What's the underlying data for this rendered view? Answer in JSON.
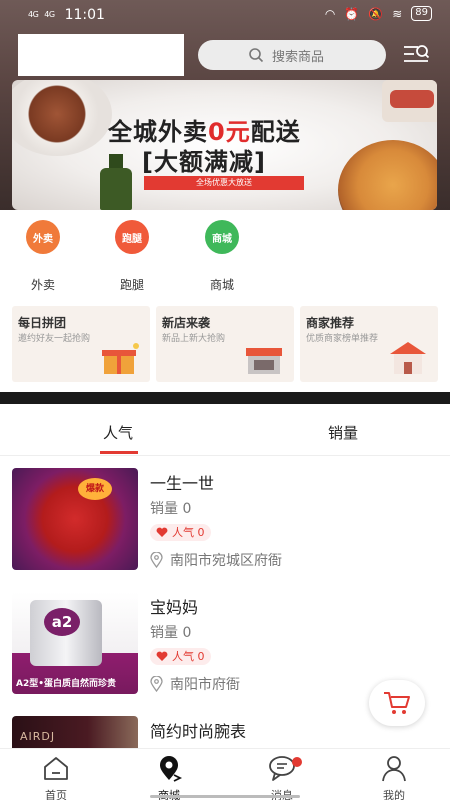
{
  "status_bar": {
    "network_1": "4G",
    "network_2": "4G",
    "time": "11:01",
    "battery": "89"
  },
  "header": {
    "search_placeholder": "搜索商品"
  },
  "banner": {
    "headline_part1": "全城外卖",
    "headline_highlight": "0元",
    "headline_part2": "配送",
    "subline": "[大额满减]",
    "tag": "全场优惠大放送"
  },
  "quick_entries": [
    {
      "icon_text": "外卖",
      "label": "外卖",
      "color": "#f07a3a"
    },
    {
      "icon_text": "跑腿",
      "label": "跑腿",
      "color": "#f05a3a"
    },
    {
      "icon_text": "商城",
      "label": "商城",
      "color": "#3fb85a"
    }
  ],
  "promos": [
    {
      "title": "每日拼团",
      "subtitle": "邀约好友一起抢购"
    },
    {
      "title": "新店来袭",
      "subtitle": "新品上新大抢购"
    },
    {
      "title": "商家推荐",
      "subtitle": "优质商家榜单推荐"
    }
  ],
  "tabs": {
    "popular": "人气",
    "sales": "销量"
  },
  "products": [
    {
      "title": "一生一世",
      "sales": "销量 0",
      "popularity": "人气 0",
      "address": "南阳市宛城区府衙",
      "badge": "爆款"
    },
    {
      "title": "宝妈妈",
      "sales": "销量 0",
      "popularity": "人气 0",
      "address": "南阳市府衙",
      "thumb_logo": "a2",
      "thumb_caption": "A2型•蛋白质自然而珍贵"
    },
    {
      "title": "简约时尚腕表",
      "thumb_brand": "AIRDJ"
    }
  ],
  "bottom_nav": [
    {
      "label": "首页",
      "icon": "home-icon"
    },
    {
      "label": "商城",
      "icon": "map-pin-icon"
    },
    {
      "label": "消息",
      "icon": "message-icon"
    },
    {
      "label": "我的",
      "icon": "user-icon"
    }
  ],
  "colors": {
    "accent": "#e23a32",
    "header_bg": "#5a4542"
  }
}
